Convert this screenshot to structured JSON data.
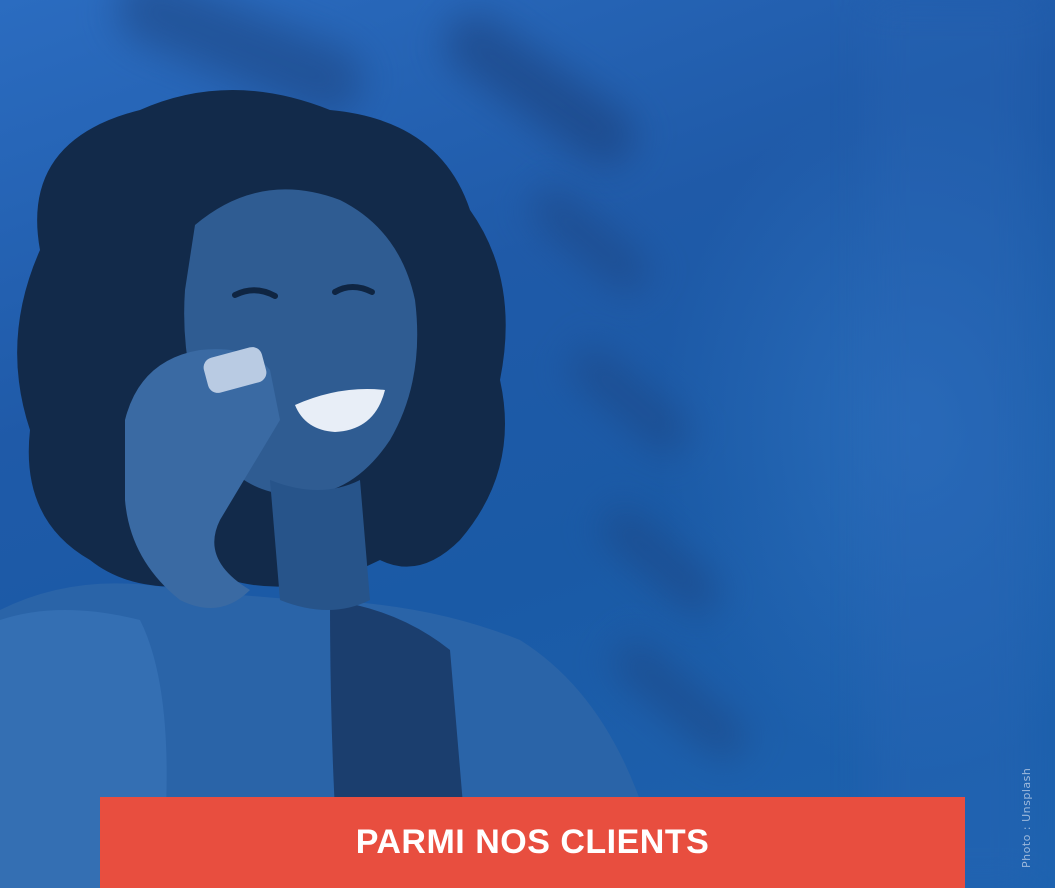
{
  "hero": {
    "photo_description_icon": "woman-on-phone-photo",
    "tint_color": "#1f5aa8"
  },
  "banner": {
    "label": "PARMI NOS CLIENTS",
    "color": "#e84e3f"
  },
  "credit": {
    "text": "Photo : Unsplash"
  }
}
